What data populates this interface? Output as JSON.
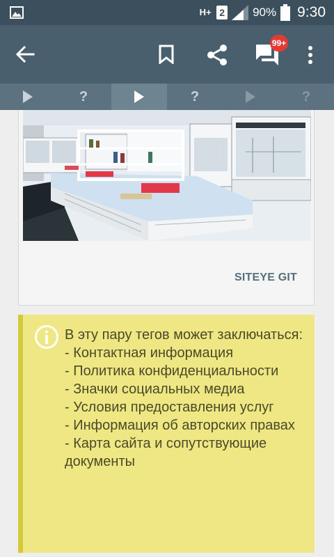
{
  "status_bar": {
    "network": "H+",
    "sim": "2",
    "battery_percent": "90%",
    "time": "9:30"
  },
  "app_bar": {
    "icons": [
      "back-arrow-icon",
      "bookmark-icon",
      "share-icon",
      "chat-icon",
      "more-vert-icon"
    ],
    "badge": "99+"
  },
  "nav_strip": {
    "items": [
      "play-icon",
      "?",
      "play-icon",
      "?",
      "play-icon",
      "?"
    ]
  },
  "card": {
    "caption": "SITEYE GIT"
  },
  "info": {
    "intro": "В эту пару тегов может заключаться:",
    "items": [
      "- Контактная информация",
      "- Политика конфиденциальности",
      "- Значки социальных медиа",
      "- Условия предоставления услуг",
      "- Информация об авторских правах",
      "- Карта сайта и сопутствующие документы"
    ]
  },
  "colors": {
    "status_bar": "#3b4f5d",
    "app_bar": "#4a5f6d",
    "nav_strip": "#5c7280",
    "info_bg": "#efe684",
    "info_border": "#d3ca3b",
    "badge": "#e53935"
  }
}
